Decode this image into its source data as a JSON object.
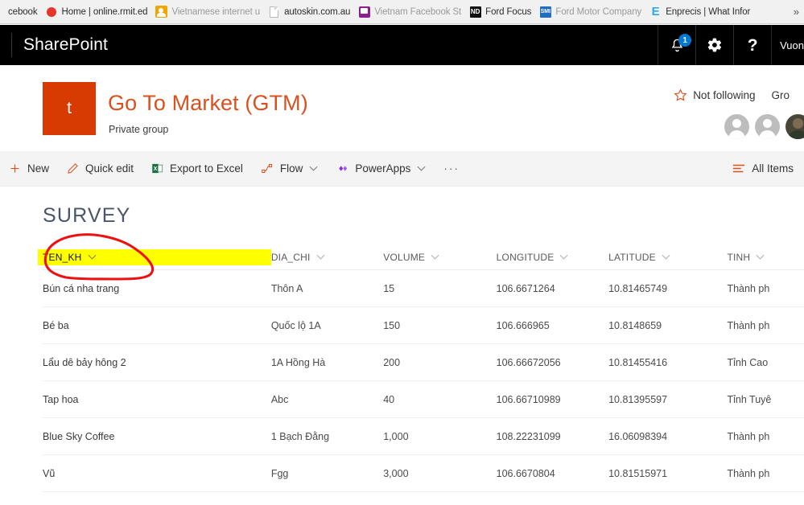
{
  "browser": {
    "bookmarks": [
      {
        "label": "cebook",
        "icon": "none",
        "truncated_left": true
      },
      {
        "label": "Home | online.rmit.ed",
        "icon": "red-dot-icon"
      },
      {
        "label": "Vietnamese internet u",
        "icon": "yellow-person-icon",
        "fade_tail": true
      },
      {
        "label": "autoskin.com.au",
        "icon": "document-icon"
      },
      {
        "label": "Vietnam Facebook St",
        "icon": "purple-chat-icon",
        "fade_tail": true
      },
      {
        "label": "Ford Focus",
        "icon": "nd-icon"
      },
      {
        "label": "Ford Motor Company",
        "icon": "smi-icon",
        "fade_tail": true
      },
      {
        "label": "Enprecis | What Infor",
        "icon": "e-logo-icon"
      }
    ],
    "overflow_label": "»"
  },
  "suite": {
    "brand": "SharePoint",
    "notifications_badge": "1",
    "user_label": "Vuon",
    "icons": {
      "notifications": "bell-icon",
      "settings": "gear-icon",
      "help": "question-mark-icon"
    }
  },
  "site": {
    "logo_letter": "t",
    "title": "Go To Market (GTM)",
    "subtitle": "Private group",
    "follow_label": "Not following",
    "follow_icon": "star-icon",
    "group_label": "Gro",
    "logo_color": "#d83b01",
    "title_color": "#d8511f"
  },
  "commandbar": {
    "items": [
      {
        "label": "New",
        "icon": "plus-icon",
        "has_chevron": false
      },
      {
        "label": "Quick edit",
        "icon": "pencil-icon",
        "has_chevron": false
      },
      {
        "label": "Export to Excel",
        "icon": "excel-icon",
        "has_chevron": false
      },
      {
        "label": "Flow",
        "icon": "flow-icon",
        "has_chevron": true
      },
      {
        "label": "PowerApps",
        "icon": "powerapps-icon",
        "has_chevron": true
      },
      {
        "label": "···",
        "icon": "ellipsis-icon",
        "has_chevron": false
      }
    ],
    "view_label": "All Items",
    "view_icon": "list-view-icon"
  },
  "list": {
    "title": "SURVEY",
    "columns": [
      {
        "key": "TEN_KH",
        "label": "TEN_KH",
        "highlighted": true
      },
      {
        "key": "DIA_CHI",
        "label": "DIA_CHI",
        "highlighted": false
      },
      {
        "key": "VOLUME",
        "label": "VOLUME",
        "highlighted": false
      },
      {
        "key": "LONGITUDE",
        "label": "LONGITUDE",
        "highlighted": false
      },
      {
        "key": "LATITUDE",
        "label": "LATITUDE",
        "highlighted": false
      },
      {
        "key": "TINH",
        "label": "TINH",
        "highlighted": false
      }
    ],
    "rows": [
      {
        "TEN_KH": "Bún cá nha trang",
        "DIA_CHI": "Thôn A",
        "VOLUME": "15",
        "LONGITUDE": "106.6671264",
        "LATITUDE": "10.81465749",
        "TINH": "Thành ph"
      },
      {
        "TEN_KH": "Bé ba",
        "DIA_CHI": "Quốc lộ 1A",
        "VOLUME": "150",
        "LONGITUDE": "106.666965",
        "LATITUDE": "10.8148659",
        "TINH": "Thành ph"
      },
      {
        "TEN_KH": "Lẩu dê bảy hông 2",
        "DIA_CHI": "1A Hồng Hà",
        "VOLUME": "200",
        "LONGITUDE": "106.66672056",
        "LATITUDE": "10.81455416",
        "TINH": "Tỉnh Cao"
      },
      {
        "TEN_KH": "Tap hoa",
        "DIA_CHI": "Abc",
        "VOLUME": "40",
        "LONGITUDE": "106.66710989",
        "LATITUDE": "10.81395597",
        "TINH": "Tỉnh Tuyê"
      },
      {
        "TEN_KH": "Blue Sky Coffee",
        "DIA_CHI": "1 Bạch Đằng",
        "VOLUME": "1,000",
        "LONGITUDE": "108.22231099",
        "LATITUDE": "16.06098394",
        "TINH": "Thành ph"
      },
      {
        "TEN_KH": "Vũ",
        "DIA_CHI": "Fgg",
        "VOLUME": "3,000",
        "LONGITUDE": "106.6670804",
        "LATITUDE": "10.81515971",
        "TINH": "Thành ph"
      }
    ]
  },
  "annotation": {
    "type": "hand-drawn-red-circle",
    "target": "TEN_KH",
    "color": "#ee1111",
    "highlight_color": "#ffff00"
  }
}
